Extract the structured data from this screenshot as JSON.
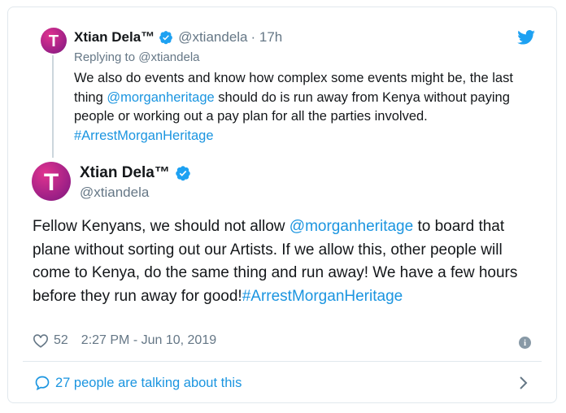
{
  "reply": {
    "author_name": "Xtian Dela™",
    "author_handle": "@xtiandela",
    "time": "· 17h",
    "replying_prefix": "Replying to ",
    "replying_handle": "@xtiandela",
    "text_part1": "We also do events and know how complex some events might be, the last thing ",
    "mention": "@morganheritage",
    "text_part2": " should do is run away from Kenya without paying people or working out a pay plan for all the parties involved. ",
    "hashtag": "#ArrestMorganHeritage"
  },
  "main": {
    "author_name": "Xtian Dela™",
    "author_handle": "@xtiandela",
    "text_part1": "Fellow Kenyans, we should not allow ",
    "mention": "@morganheritage",
    "text_part2": " to board that plane without sorting out our Artists. If we allow this, other people will come to Kenya, do the same thing and run away! We have a few hours before they run away for good!",
    "hashtag": "#ArrestMorganHeritage"
  },
  "meta": {
    "likes": "52",
    "timestamp": "2:27 PM - Jun 10, 2019"
  },
  "footer": {
    "talking": "27 people are talking about this"
  },
  "avatar_letter": "T",
  "info_glyph": "i",
  "colors": {
    "link": "#1b95e0",
    "muted": "#657786",
    "avatar": "#b0248a"
  },
  "icons": [
    "verified-badge-icon",
    "twitter-bird-icon",
    "heart-icon",
    "info-icon",
    "speech-bubble-icon",
    "chevron-right-icon"
  ]
}
